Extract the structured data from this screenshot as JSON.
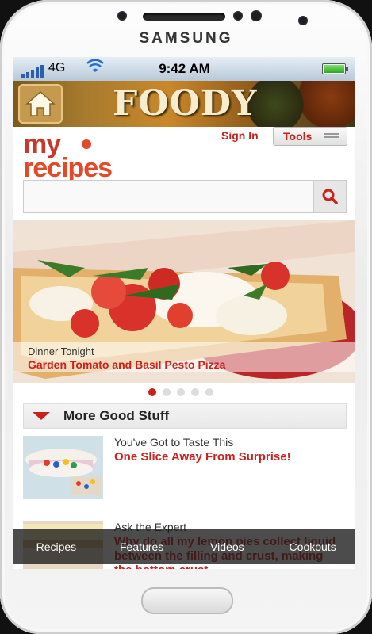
{
  "device": {
    "brand": "SAMSUNG"
  },
  "status_bar": {
    "network": "4G",
    "time": "9:42 AM",
    "battery_level_pct": 100,
    "signal-icon": "signal-bars-icon",
    "wifi-icon": "wifi-icon"
  },
  "app_header": {
    "title": "FOODY",
    "home_icon": "house-icon"
  },
  "site": {
    "logo_line1": "my",
    "logo_line2": "recipes",
    "sign_in": "Sign In",
    "tools": "Tools",
    "search_placeholder": "",
    "search_icon": "search-icon"
  },
  "hero": {
    "kicker": "Dinner Tonight",
    "title": "Garden Tomato and Basil Pesto Pizza",
    "carousel_pages": 5,
    "carousel_active": 1
  },
  "section": {
    "title": "More Good Stuff"
  },
  "items": [
    {
      "kicker": "You've Got to Taste This",
      "headline": "One Slice Away From Surprise!"
    },
    {
      "kicker": "Ask the Expert",
      "headline": "Why do all my lemon pies collect liquid between the filling and crust, making the bottom crust"
    }
  ],
  "tabs": [
    "Recipes",
    "Features",
    "Videos",
    "Cookouts"
  ],
  "colors": {
    "accent": "#c8221c",
    "logo": "#e24a2a"
  }
}
